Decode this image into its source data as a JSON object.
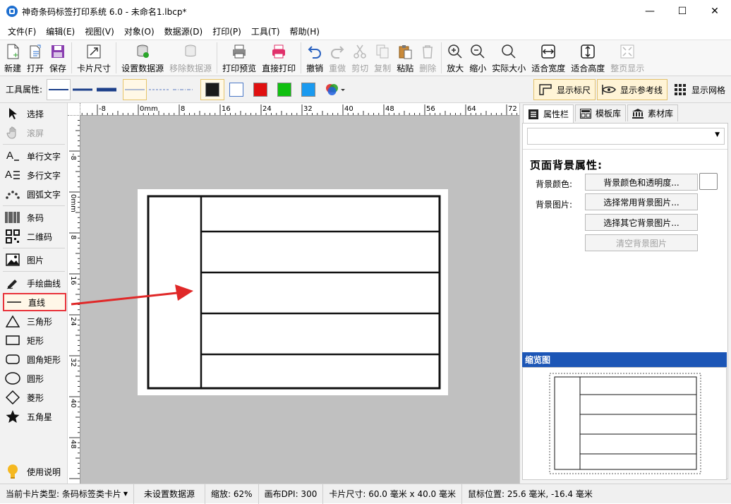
{
  "window": {
    "title": "神奇条码标签打印系统 6.0 - 未命名1.lbcp*",
    "minimize": "—",
    "maximize": "☐",
    "close": "✕"
  },
  "menu": [
    "文件(F)",
    "编辑(E)",
    "视图(V)",
    "对象(O)",
    "数据源(D)",
    "打印(P)",
    "工具(T)",
    "帮助(H)"
  ],
  "toolbar": {
    "new": "新建",
    "open": "打开",
    "save": "保存",
    "card_size": "卡片尺寸",
    "set_datasource": "设置数据源",
    "remove_datasource": "移除数据源",
    "print_preview": "打印预览",
    "direct_print": "直接打印",
    "undo": "撤销",
    "redo": "重做",
    "cut": "剪切",
    "copy": "复制",
    "paste": "粘贴",
    "delete": "删除",
    "zoom_in": "放大",
    "zoom_out": "缩小",
    "actual_size": "实际大小",
    "fit_width": "适合宽度",
    "fit_height": "适合高度",
    "full_page": "整页显示"
  },
  "propbar": {
    "label": "工具属性:",
    "show_ruler": "显示标尺",
    "show_guides": "显示参考线",
    "show_grid": "显示网格",
    "colors": [
      "#1a1a1a",
      "#ffffff",
      "#e01010",
      "#10c010",
      "#1a9af0"
    ]
  },
  "tools": {
    "select": "选择",
    "scroll": "滚屏",
    "single_text": "单行文字",
    "multi_text": "多行文字",
    "arc_text": "圆弧文字",
    "barcode": "条码",
    "qrcode": "二维码",
    "image": "图片",
    "freehand": "手绘曲线",
    "line": "直线",
    "triangle": "三角形",
    "rectangle": "矩形",
    "rounded_rect": "圆角矩形",
    "circle": "圆形",
    "diamond": "菱形",
    "star": "五角星",
    "help": "使用说明"
  },
  "ruler": {
    "top_labels": [
      "-8",
      "0mm",
      "8",
      "16",
      "24",
      "32",
      "40",
      "48",
      "56",
      "64",
      "72"
    ],
    "left_labels": [
      "-8",
      "0mm",
      "8",
      "16",
      "24",
      "32",
      "40",
      "48"
    ]
  },
  "right_panel": {
    "tabs": [
      "属性栏",
      "模板库",
      "素材库"
    ],
    "section_title": "页面背景属性:",
    "bg_color_label": "背景颜色:",
    "bg_image_label": "背景图片:",
    "btn_color": "背景颜色和透明度...",
    "btn_common_image": "选择常用背景图片...",
    "btn_other_image": "选择其它背景图片...",
    "btn_clear_image": "清空背景图片",
    "preview_title": "缩览图"
  },
  "status": {
    "card_type": "当前卡片类型: 条码标签类卡片",
    "datasource": "未设置数据源",
    "zoom": "缩放: 62%",
    "dpi": "画布DPI: 300",
    "card_size": "卡片尺寸: 60.0 毫米 x 40.0 毫米",
    "mouse_pos": "鼠标位置: 25.6 毫米, -16.4 毫米"
  }
}
